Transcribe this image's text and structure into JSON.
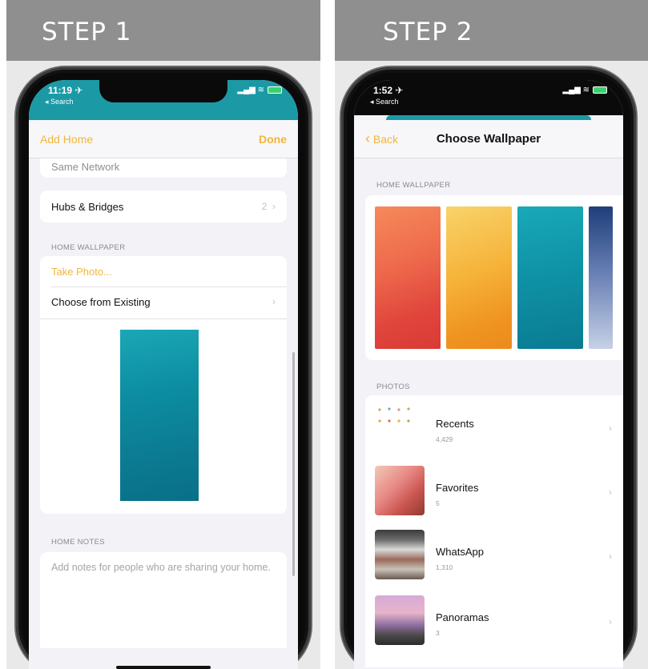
{
  "step1": {
    "title": "STEP 1",
    "status": {
      "time": "11:19 ✈",
      "back": "◂ Search",
      "icons": "▂▄▆ ≋"
    },
    "nav": {
      "left": "Add Home",
      "right": "Done"
    },
    "rows": {
      "same_network": "Same Network",
      "hubs_label": "Hubs & Bridges",
      "hubs_count": "2",
      "take_photo": "Take Photo...",
      "choose_existing": "Choose from Existing"
    },
    "sections": {
      "wallpaper": "HOME WALLPAPER",
      "notes": "HOME NOTES"
    },
    "notes_placeholder": "Add notes for people who are sharing your home.",
    "colors": {
      "accent": "#f0b63c",
      "status_bar": "#1b9aa6"
    }
  },
  "step2": {
    "title": "STEP 2",
    "status": {
      "time": "1:52 ✈",
      "back": "◂ Search",
      "icons": "▂▄▆ ≋"
    },
    "nav": {
      "back": "Back",
      "title": "Choose Wallpaper"
    },
    "sections": {
      "wallpaper": "HOME WALLPAPER",
      "photos": "PHOTOS"
    },
    "albums": [
      {
        "name": "Recents",
        "count": "4,429"
      },
      {
        "name": "Favorites",
        "count": "5"
      },
      {
        "name": "WhatsApp",
        "count": "1,310"
      },
      {
        "name": "Panoramas",
        "count": "3"
      }
    ]
  },
  "icons": {
    "chevron": "chevron-right-icon",
    "back_chevron": "chevron-left-icon"
  }
}
